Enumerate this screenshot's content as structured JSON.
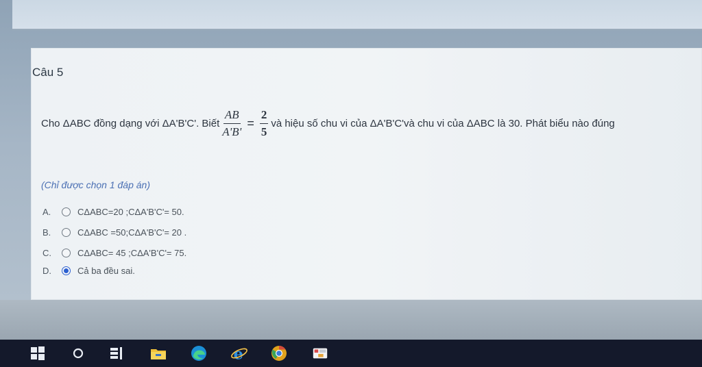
{
  "question": {
    "title": "Câu 5",
    "text_part1": "Cho ΔABC đồng dạng với ΔA'B'C'. Biết",
    "fraction1_num": "AB",
    "fraction1_den": "A'B'",
    "equals": "=",
    "fraction2_num": "2",
    "fraction2_den": "5",
    "text_part2": "và hiệu số chu vi của ΔA'B'C'và chu vi của ΔABC là 30. Phát biểu nào đúng",
    "hint": "(Chỉ được chọn 1 đáp án)"
  },
  "options": [
    {
      "letter": "A.",
      "text": "CΔABC=20 ;CΔA'B'C'= 50.",
      "selected": false
    },
    {
      "letter": "B.",
      "text": "CΔABC =50;CΔA'B'C'= 20 .",
      "selected": false
    },
    {
      "letter": "C.",
      "text": "CΔABC= 45 ;CΔA'B'C'= 75.",
      "selected": false
    },
    {
      "letter": "D.",
      "text": "Cả ba đều sai.",
      "selected": true
    }
  ],
  "taskbar": {
    "icons": [
      "windows-start-icon",
      "search-icon",
      "task-view-icon",
      "file-explorer-icon",
      "edge-icon",
      "internet-explorer-icon",
      "chrome-icon",
      "app-icon"
    ]
  },
  "colors": {
    "accent": "#2b5fd0",
    "hint": "#4a6fb3",
    "taskbar": "#14192b"
  }
}
